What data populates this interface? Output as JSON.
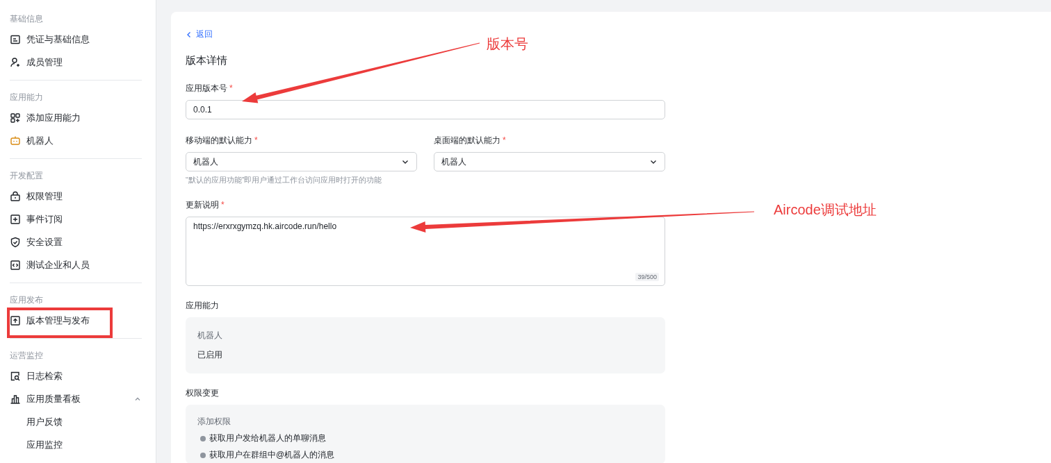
{
  "sidebar": {
    "sections": [
      {
        "title": "基础信息",
        "items": [
          {
            "label": "凭证与基础信息"
          },
          {
            "label": "成员管理"
          }
        ]
      },
      {
        "title": "应用能力",
        "items": [
          {
            "label": "添加应用能力"
          },
          {
            "label": "机器人"
          }
        ]
      },
      {
        "title": "开发配置",
        "items": [
          {
            "label": "权限管理"
          },
          {
            "label": "事件订阅"
          },
          {
            "label": "安全设置"
          },
          {
            "label": "测试企业和人员"
          }
        ]
      },
      {
        "title": "应用发布",
        "items": [
          {
            "label": "版本管理与发布"
          }
        ]
      },
      {
        "title": "运营监控",
        "items": [
          {
            "label": "日志检索"
          },
          {
            "label": "应用质量看板",
            "expanded": true,
            "children": [
              {
                "label": "用户反馈"
              },
              {
                "label": "应用监控"
              }
            ]
          }
        ]
      }
    ]
  },
  "main": {
    "back_link": "返回",
    "title": "版本详情",
    "version_field": {
      "label": "应用版本号",
      "required_mark": "*",
      "value": "0.0.1"
    },
    "select_fields": [
      {
        "label": "移动端的默认能力",
        "required_mark": "*",
        "value": "机器人"
      },
      {
        "label": "桌面端的默认能力",
        "required_mark": "*",
        "value": "机器人"
      }
    ],
    "select_hint": "“默认的应用功能”即用户通过工作台访问应用时打开的功能",
    "notes_field": {
      "label": "更新说明",
      "required_mark": "*",
      "value": "https://erxrxgymzq.hk.aircode.run/hello",
      "counter": "39/500"
    },
    "capability": {
      "label": "应用能力",
      "name": "机器人",
      "status": "已启用"
    },
    "permissions": {
      "label": "权限变更",
      "heading": "添加权限",
      "items": [
        "获取用户发给机器人的单聊消息",
        "获取用户在群组中@机器人的消息"
      ]
    }
  },
  "annotations": [
    {
      "text": "版本号"
    },
    {
      "text": "Aircode调试地址"
    }
  ]
}
